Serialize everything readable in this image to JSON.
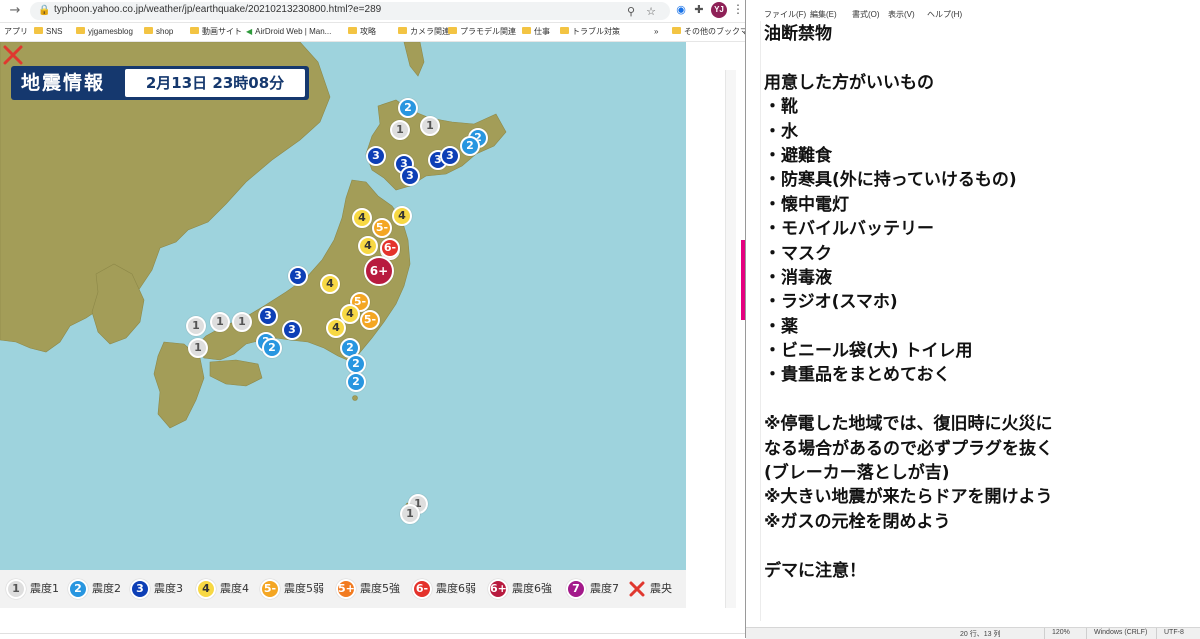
{
  "browser": {
    "url": "typhoon.yahoo.co.jp/weather/jp/earthquake/20210213230800.html?e=289",
    "profile_initials": "YJ",
    "bookmarks": [
      {
        "label": "アプリ",
        "type": "apps"
      },
      {
        "label": "SNS",
        "type": "folder"
      },
      {
        "label": "yjgamesblog",
        "type": "folder"
      },
      {
        "label": "shop",
        "type": "folder"
      },
      {
        "label": "動画サイト",
        "type": "folder"
      },
      {
        "label": "AirDroid Web | Man...",
        "type": "link"
      },
      {
        "label": "攻略",
        "type": "folder"
      },
      {
        "label": "カメラ関連",
        "type": "folder"
      },
      {
        "label": "プラモデル関連",
        "type": "folder"
      },
      {
        "label": "仕事",
        "type": "folder"
      },
      {
        "label": "トラブル対策",
        "type": "folder"
      },
      {
        "label": "その他のブックマーク",
        "type": "folder"
      }
    ]
  },
  "map": {
    "title_label": "地震情報",
    "title_date": "2月13日 23時08分",
    "colors": {
      "sea": "#9ed3dd",
      "land": "#a39d58",
      "epicenter": "#e0382f"
    },
    "markers": [
      {
        "level": "2",
        "cls": "lv2"
      },
      {
        "level": "1",
        "cls": "lv1"
      },
      {
        "level": "1",
        "cls": "lv1"
      },
      {
        "level": "2",
        "cls": "lv2"
      },
      {
        "level": "3",
        "cls": "lv3"
      },
      {
        "level": "3",
        "cls": "lv3"
      },
      {
        "level": "3",
        "cls": "lv3"
      },
      {
        "level": "3",
        "cls": "lv3"
      },
      {
        "level": "3",
        "cls": "lv3"
      },
      {
        "level": "2",
        "cls": "lv2"
      },
      {
        "level": "4",
        "cls": "lv4"
      },
      {
        "level": "4",
        "cls": "lv4"
      },
      {
        "level": "5-",
        "cls": "lv5m"
      },
      {
        "level": "4",
        "cls": "lv4"
      },
      {
        "level": "5+",
        "cls": "lv5p"
      },
      {
        "level": "6-",
        "cls": "lv6m"
      },
      {
        "level": "6+",
        "cls": "lv6p"
      },
      {
        "level": "3",
        "cls": "lv3"
      },
      {
        "level": "4",
        "cls": "lv4"
      },
      {
        "level": "5-",
        "cls": "lv5m"
      },
      {
        "level": "4",
        "cls": "lv4"
      },
      {
        "level": "5-",
        "cls": "lv5m"
      },
      {
        "level": "4",
        "cls": "lv4"
      },
      {
        "level": "3",
        "cls": "lv3"
      },
      {
        "level": "3",
        "cls": "lv3"
      },
      {
        "level": "2",
        "cls": "lv2"
      },
      {
        "level": "2",
        "cls": "lv2"
      },
      {
        "level": "1",
        "cls": "lv1"
      },
      {
        "level": "1",
        "cls": "lv1"
      },
      {
        "level": "1",
        "cls": "lv1"
      },
      {
        "level": "1",
        "cls": "lv1"
      },
      {
        "level": "2",
        "cls": "lv2"
      },
      {
        "level": "2",
        "cls": "lv2"
      },
      {
        "level": "2",
        "cls": "lv2"
      },
      {
        "level": "1",
        "cls": "lv1"
      },
      {
        "level": "1",
        "cls": "lv1"
      }
    ]
  },
  "legend": [
    {
      "badge": "1",
      "cls": "lv1",
      "label": "震度1"
    },
    {
      "badge": "2",
      "cls": "lv2",
      "label": "震度2"
    },
    {
      "badge": "3",
      "cls": "lv3",
      "label": "震度3"
    },
    {
      "badge": "4",
      "cls": "lv4",
      "label": "震度4"
    },
    {
      "badge": "5-",
      "cls": "lv5m",
      "label": "震度5弱"
    },
    {
      "badge": "5+",
      "cls": "lv5p",
      "label": "震度5強"
    },
    {
      "badge": "6-",
      "cls": "lv6m",
      "label": "震度6弱"
    },
    {
      "badge": "6+",
      "cls": "lv6p",
      "label": "震度6強"
    },
    {
      "badge": "7",
      "cls": "lv7",
      "label": "震度7"
    }
  ],
  "legend_epicenter_label": "震央",
  "notepad": {
    "menu": [
      "ファイル(F)",
      "編集(E)",
      "書式(O)",
      "表示(V)",
      "ヘルプ(H)"
    ],
    "lines": [
      "油断禁物",
      "",
      "用意した方がいいもの",
      "・靴",
      "・水",
      "・避難食",
      "・防寒具(外に持っていけるもの)",
      "・懐中電灯",
      "・モバイルバッテリー",
      "・マスク",
      "・消毒液",
      "・ラジオ(スマホ)",
      "・薬",
      "・ビニール袋(大) トイレ用",
      "・貴重品をまとめておく",
      "",
      "※停電した地域では、復旧時に火災に",
      "なる場合があるので必ずプラグを抜く",
      "(ブレーカー落としが吉)",
      "※大きい地震が来たらドアを開けよう",
      "※ガスの元栓を閉めよう",
      "",
      "デマに注意！"
    ],
    "status": {
      "position": "20 行、13 列",
      "zoom": "120%",
      "line_ending": "Windows (CRLF)",
      "encoding": "UTF-8"
    }
  }
}
